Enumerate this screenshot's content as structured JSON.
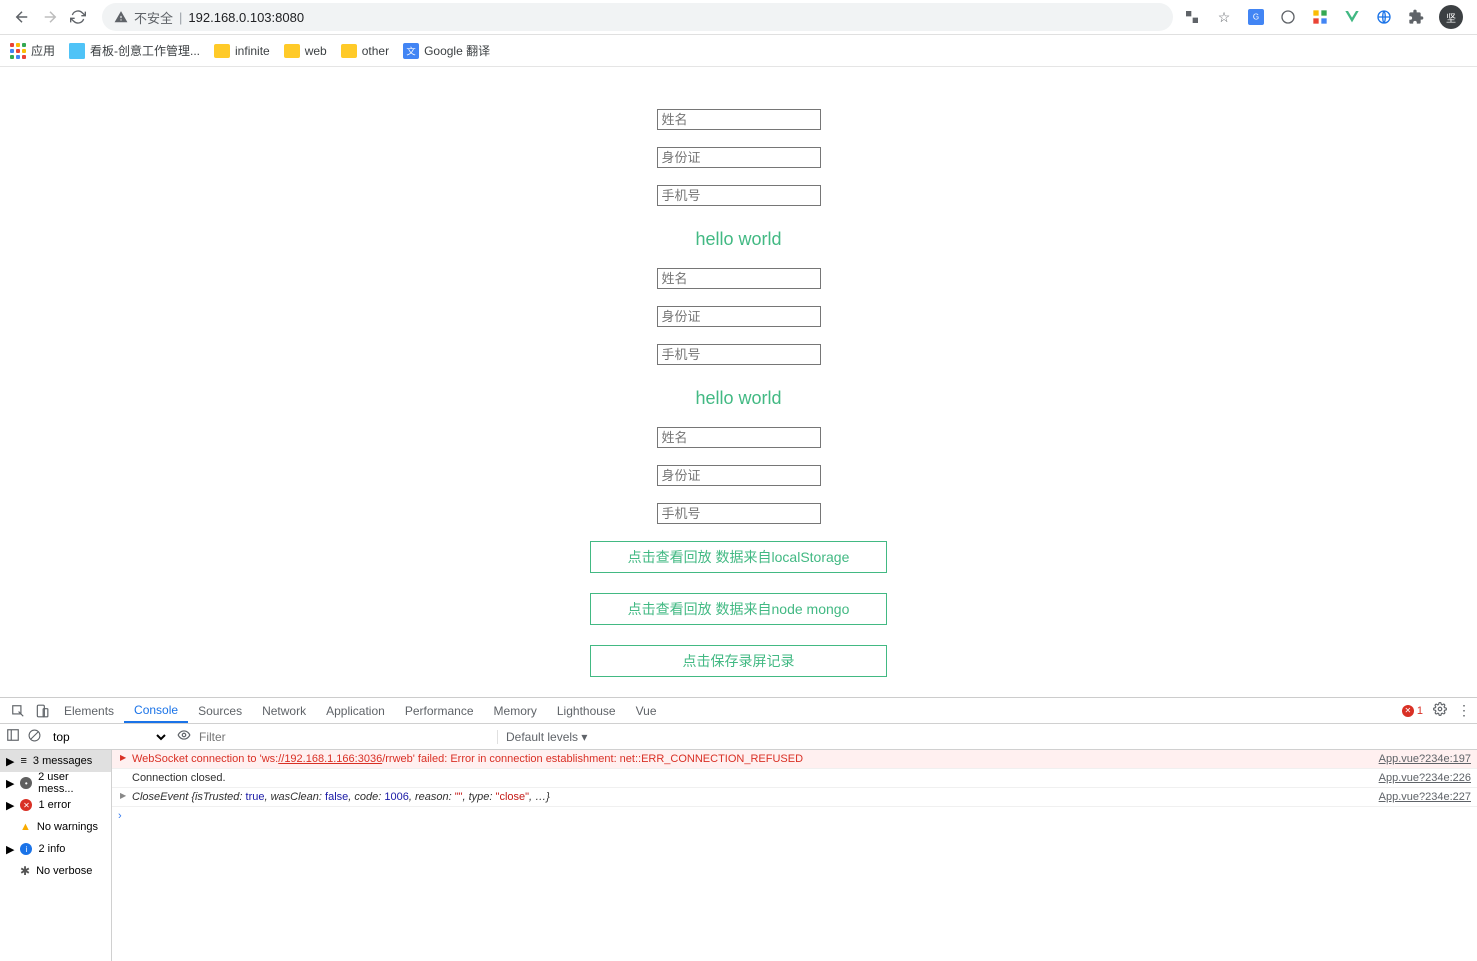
{
  "browser": {
    "insecure_label": "不安全",
    "url": "192.168.0.103:8080",
    "extensions_star": "☆"
  },
  "bookmarks": {
    "apps": "应用",
    "kanban": "看板-创意工作管理...",
    "infinite": "infinite",
    "web": "web",
    "other": "other",
    "translate": "Google 翻译"
  },
  "form": {
    "name_ph": "姓名",
    "id_ph": "身份证",
    "phone_ph": "手机号",
    "hello": "hello world",
    "btn_local": "点击查看回放 数据来自localStorage",
    "btn_mongo": "点击查看回放 数据来自node mongo",
    "btn_save": "点击保存录屏记录"
  },
  "devtools": {
    "tabs": [
      "Elements",
      "Console",
      "Sources",
      "Network",
      "Application",
      "Performance",
      "Memory",
      "Lighthouse",
      "Vue"
    ],
    "error_count": "1",
    "toolbar": {
      "context": "top",
      "filter_ph": "Filter",
      "levels": "Default levels ▾"
    },
    "sidebar": {
      "messages": "3 messages",
      "user": "2 user mess...",
      "errors": "1 error",
      "warnings": "No warnings",
      "info": "2 info",
      "verbose": "No verbose"
    },
    "console": {
      "err_pre": "WebSocket connection to 'ws:",
      "err_url": "//192.168.1.166:3036",
      "err_post": "/rrweb' failed: Error in connection establishment: net::ERR_CONNECTION_REFUSED",
      "err_src": "App.vue?234e:197",
      "closed": "Connection closed.",
      "closed_src": "App.vue?234e:226",
      "evt_pre": "CloseEvent ",
      "evt_body_1": "{isTrusted: ",
      "evt_true": "true",
      "evt_body_2": ", wasClean: ",
      "evt_false": "false",
      "evt_body_3": ", code: ",
      "evt_code": "1006",
      "evt_body_4": ", reason: ",
      "evt_reason": "\"\"",
      "evt_body_5": ", type: ",
      "evt_type": "\"close\"",
      "evt_body_6": ", …}",
      "evt_src": "App.vue?234e:227"
    }
  }
}
